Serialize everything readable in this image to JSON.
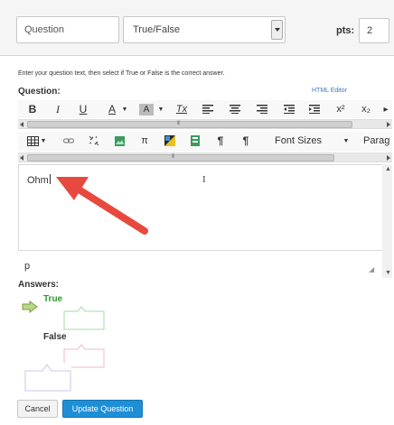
{
  "question_name": "Question",
  "question_type": {
    "selected": "True/False"
  },
  "points": {
    "label": "pts:",
    "value": "2"
  },
  "instructions": "Enter your question text, then select if True or False is the correct answer.",
  "question_label": "Question:",
  "html_editor_link": "HTML Editor",
  "toolbar1": {
    "bold": "B",
    "italic": "I",
    "underline": "U",
    "font_color": "A",
    "bg_color": "A",
    "clear_format": "Tx",
    "superscript": "x²",
    "subscript": "x₂",
    "scroll_grip": "III"
  },
  "toolbar2": {
    "font_sizes": "Font Sizes",
    "paragraph": "Parag",
    "scroll_grip": "III"
  },
  "editor": {
    "content": "Ohm"
  },
  "element_path": "p",
  "answers_label": "Answers:",
  "answers": [
    {
      "label": "True",
      "correct": true,
      "color": "#2e9c2e"
    },
    {
      "label": "False",
      "correct": false,
      "color": "#333333"
    }
  ],
  "buttons": {
    "cancel": "Cancel",
    "update": "Update Question"
  },
  "colors": {
    "accent": "#1e8fd6",
    "true_green": "#2e9c2e",
    "arrow_red": "#e8493e"
  }
}
